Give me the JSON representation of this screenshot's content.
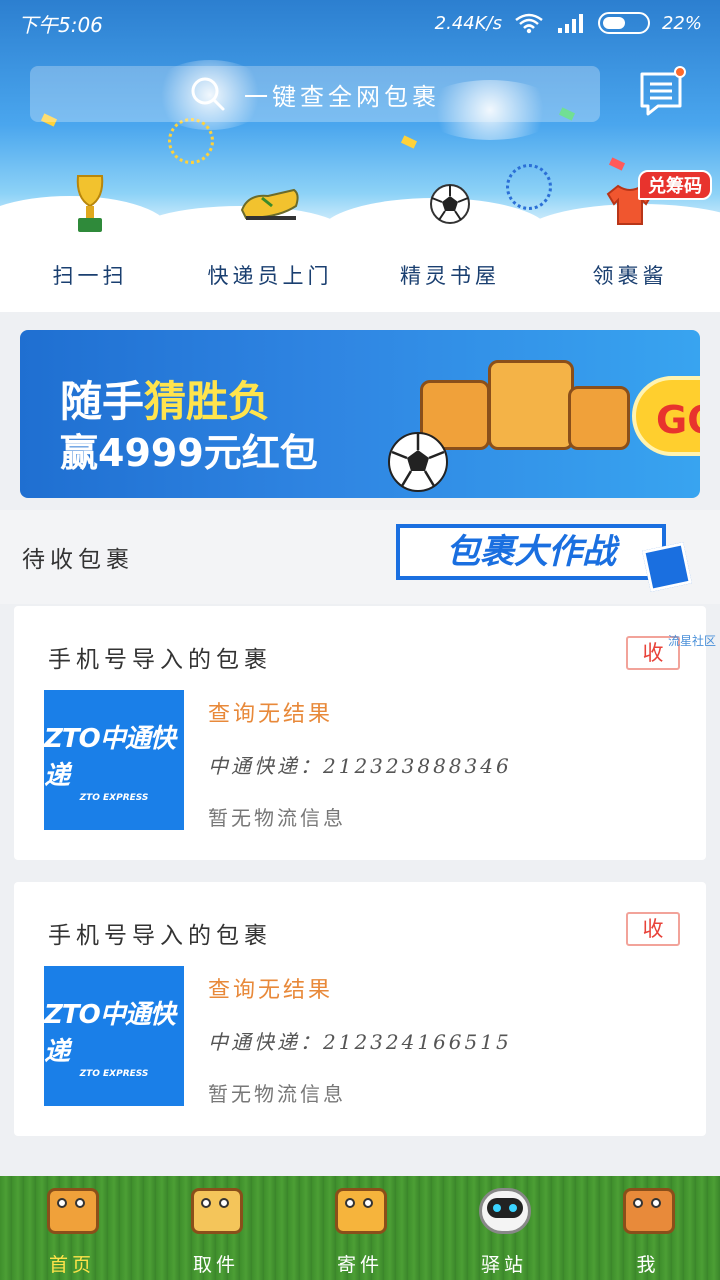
{
  "status_bar": {
    "time": "下午5:06",
    "network_speed": "2.44K/s",
    "battery": "22%"
  },
  "header": {
    "search_placeholder": "一键查全网包裹"
  },
  "quick_actions": [
    {
      "label": "扫一扫",
      "icon": "trophy-icon"
    },
    {
      "label": "快递员上门",
      "icon": "soccer-shoe-icon"
    },
    {
      "label": "精灵书屋",
      "icon": "soccer-ball-icon"
    },
    {
      "label": "领裹酱",
      "icon": "jersey-icon"
    }
  ],
  "redeem_badge": "兑筹码",
  "promo": {
    "line1_prefix": "随手",
    "line1_highlight": "猜胜负",
    "line2": "赢4999元红包",
    "go_label": "GO"
  },
  "pending": {
    "section_title": "待收包裹",
    "campaign_label": "包裹大作战",
    "watermark": "流星社区",
    "packages": [
      {
        "title": "手机号导入的包裹",
        "collect_label": "收",
        "logo_main": "ZTO中通快递",
        "logo_sub": "ZTO EXPRESS",
        "result": "查询无结果",
        "tracking": "中通快递：212323888346",
        "logistics": "暂无物流信息"
      },
      {
        "title": "手机号导入的包裹",
        "collect_label": "收",
        "logo_main": "ZTO中通快递",
        "logo_sub": "ZTO EXPRESS",
        "result": "查询无结果",
        "tracking": "中通快递：212324166515",
        "logistics": "暂无物流信息"
      }
    ]
  },
  "bottom_nav": [
    {
      "label": "首页",
      "active": true
    },
    {
      "label": "取件",
      "active": false
    },
    {
      "label": "寄件",
      "active": false
    },
    {
      "label": "驿站",
      "active": false
    },
    {
      "label": "我",
      "active": false
    }
  ],
  "colors": {
    "accent_blue": "#1a7fe8",
    "orange_result": "#e8893a",
    "collect_red": "#e8433a",
    "active_nav": "#ffe34a"
  }
}
